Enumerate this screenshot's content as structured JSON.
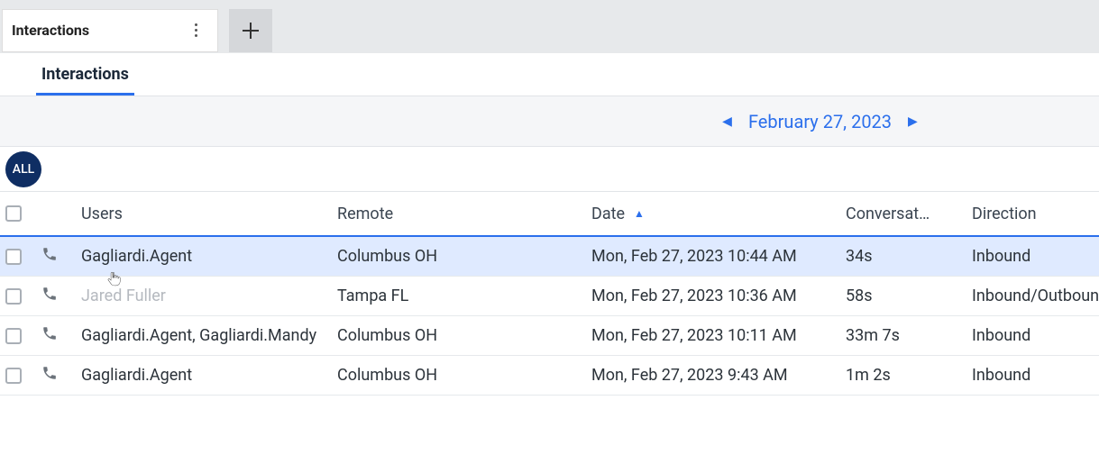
{
  "topbar": {
    "tab_title": "Interactions"
  },
  "subtab": {
    "label": "Interactions"
  },
  "date_nav": {
    "label": "February 27, 2023"
  },
  "filter": {
    "chip": "ALL"
  },
  "columns": {
    "users": "Users",
    "remote": "Remote",
    "date": "Date",
    "conversation": "Conversat…",
    "direction": "Direction"
  },
  "rows": [
    {
      "users": "Gagliardi.Agent",
      "remote": "Columbus OH",
      "date": "Mon, Feb 27, 2023 10:44 AM",
      "conversation": "34s",
      "direction": "Inbound",
      "selected": true,
      "muted": false
    },
    {
      "users": "Jared Fuller",
      "remote": "Tampa FL",
      "date": "Mon, Feb 27, 2023 10:36 AM",
      "conversation": "58s",
      "direction": "Inbound/Outbound",
      "selected": false,
      "muted": true
    },
    {
      "users": "Gagliardi.Agent, Gagliardi.Mandy",
      "remote": "Columbus OH",
      "date": "Mon, Feb 27, 2023 10:11 AM",
      "conversation": "33m 7s",
      "direction": "Inbound",
      "selected": false,
      "muted": false
    },
    {
      "users": "Gagliardi.Agent",
      "remote": "Columbus OH",
      "date": "Mon, Feb 27, 2023 9:43 AM",
      "conversation": "1m 2s",
      "direction": "Inbound",
      "selected": false,
      "muted": false
    }
  ]
}
